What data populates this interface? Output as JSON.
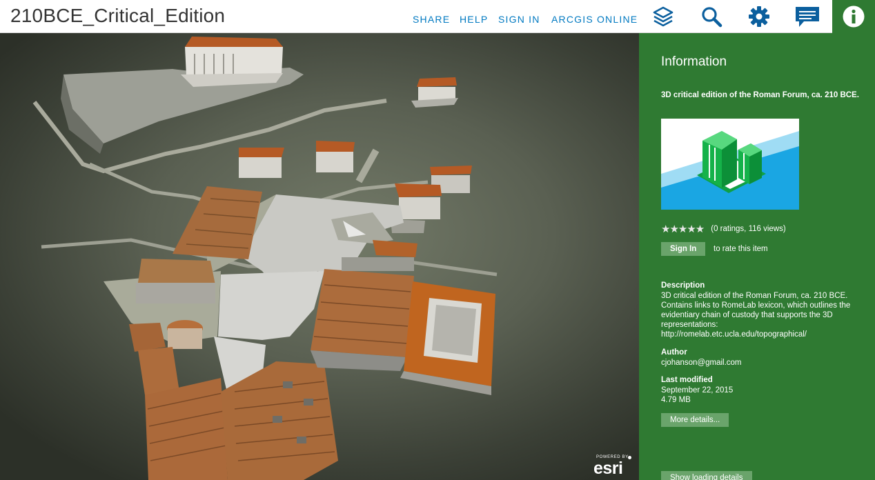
{
  "app": {
    "title": "210BCE_Critical_Edition"
  },
  "nav": {
    "share": "SHARE",
    "help": "HELP",
    "sign_in": "SIGN IN",
    "arcgis": "ARCGIS ONLINE"
  },
  "toolbar": {
    "icons": [
      "layers-icon",
      "search-icon",
      "gear-icon",
      "comment-icon",
      "info-icon"
    ],
    "active": "info-icon",
    "active_color": "#2f7a32",
    "icon_color": "#0b5f9e"
  },
  "attribution": {
    "powered_by": "POWERED BY",
    "brand": "esri"
  },
  "panel": {
    "heading": "Information",
    "snippet": "3D critical edition of the Roman Forum, ca. 210 BCE.",
    "stars": "★★★★★",
    "ratings": "(0 ratings, 116 views)",
    "sign_in_button": "Sign In",
    "rate_text": "to rate this item",
    "description_label": "Description",
    "description": "3D critical edition of the Roman Forum, ca. 210 BCE. Contains links to RomeLab lexicon, which outlines the evidentiary chain of custody that supports the 3D representations: http://romelab.etc.ucla.edu/topographical/",
    "author_label": "Author",
    "author": "cjohanson@gmail.com",
    "modified_label": "Last modified",
    "modified": "September 22, 2015",
    "size": "4.79 MB",
    "more_details_button": "More details...",
    "loading_button": "Show loading details"
  },
  "colors": {
    "panel_bg": "#2f7a32",
    "button_bg": "#6aa46b",
    "link_blue": "#0079c1"
  }
}
